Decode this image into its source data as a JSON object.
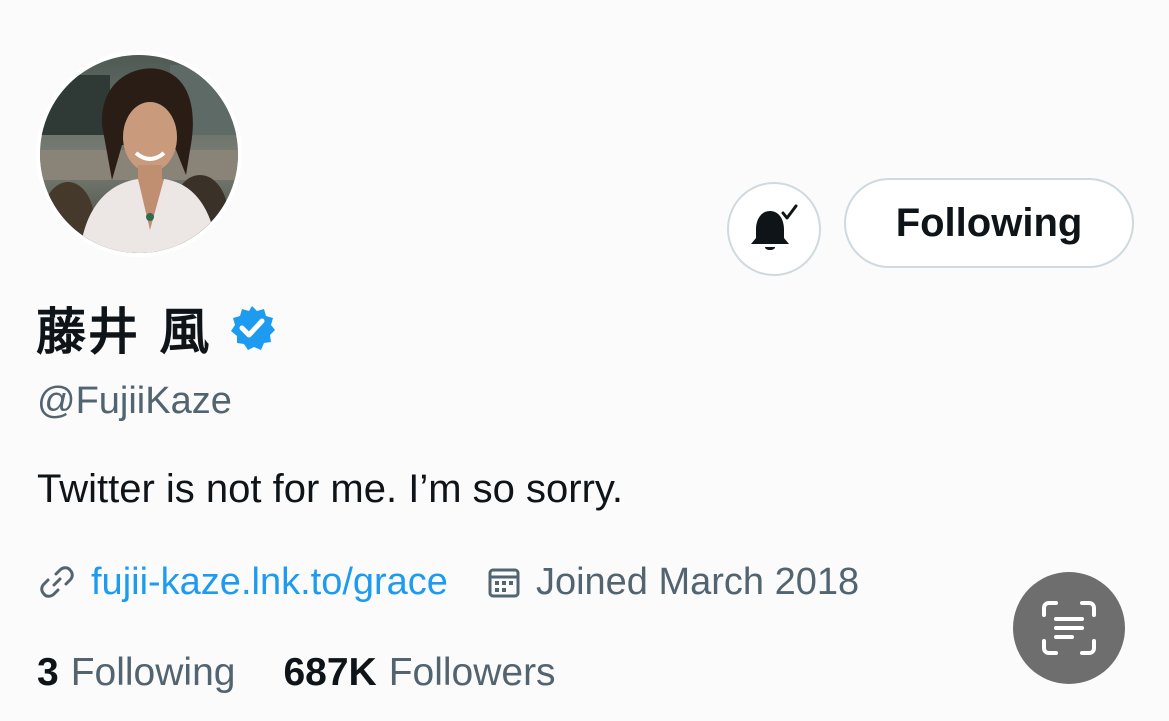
{
  "profile": {
    "display_name": "藤井 風",
    "handle": "@FujiiKaze",
    "bio": "Twitter is not for me. I’m so sorry.",
    "link": "fujii-kaze.lnk.to/grace",
    "joined": "Joined March 2018",
    "verified": true
  },
  "actions": {
    "following_label": "Following",
    "notify_icon": "bell-check-icon"
  },
  "stats": {
    "following_count": "3",
    "following_label": "Following",
    "followers_count": "687K",
    "followers_label": "Followers"
  },
  "overlay": {
    "scan_icon": "text-scan-icon"
  },
  "colors": {
    "link": "#1d9bf0",
    "secondary_text": "#536471",
    "border": "#cfd9de",
    "verified": "#1d9bf0",
    "overlay_button": "#6e6e6e"
  }
}
